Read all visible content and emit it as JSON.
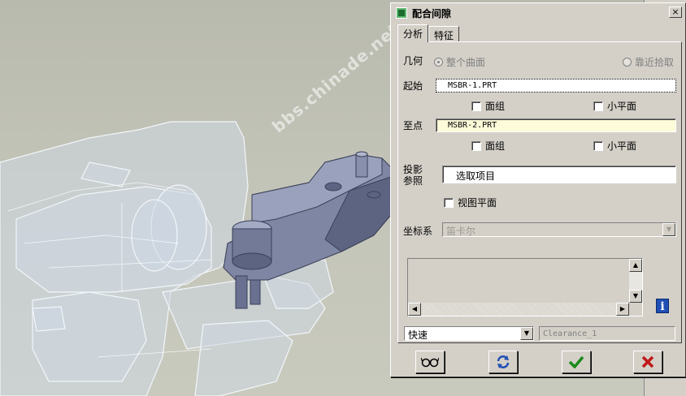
{
  "watermark": "bbs.chinade.net",
  "dialog": {
    "title": "配合间隙",
    "close_label": "×",
    "tabs": [
      {
        "label": "分析",
        "active": true
      },
      {
        "label": "特征",
        "active": false
      }
    ],
    "geometry": {
      "label": "几何",
      "option_whole_surface": "整个曲面",
      "option_near_pick": "靠近拾取"
    },
    "from": {
      "label": "起始",
      "value": "MSBR-1.PRT",
      "quilt_label": "面组",
      "small_plane_label": "小平面"
    },
    "to": {
      "label": "至点",
      "value": "MSBR-2.PRT",
      "quilt_label": "面组",
      "small_plane_label": "小平面"
    },
    "projection": {
      "label_line1": "投影",
      "label_line2": "参照",
      "value": "选取项目",
      "view_plane_label": "视图平面"
    },
    "csys": {
      "label": "坐标系",
      "value": "笛卡尔"
    },
    "mode": {
      "value": "快速",
      "name_value": "Clearance_1"
    },
    "actions": {
      "preview_icon": "glasses-icon",
      "repeat_icon": "refresh-icon",
      "ok_icon": "checkmark-icon",
      "cancel_icon": "x-icon"
    },
    "info_icon": "i",
    "colors": {
      "dialog_bg": "#d4d0c8",
      "ok_green": "#1a8a1a",
      "cancel_red": "#c01818",
      "refresh_blue": "#1f4fb5",
      "highlight_yellow": "#fdfbd9"
    }
  }
}
